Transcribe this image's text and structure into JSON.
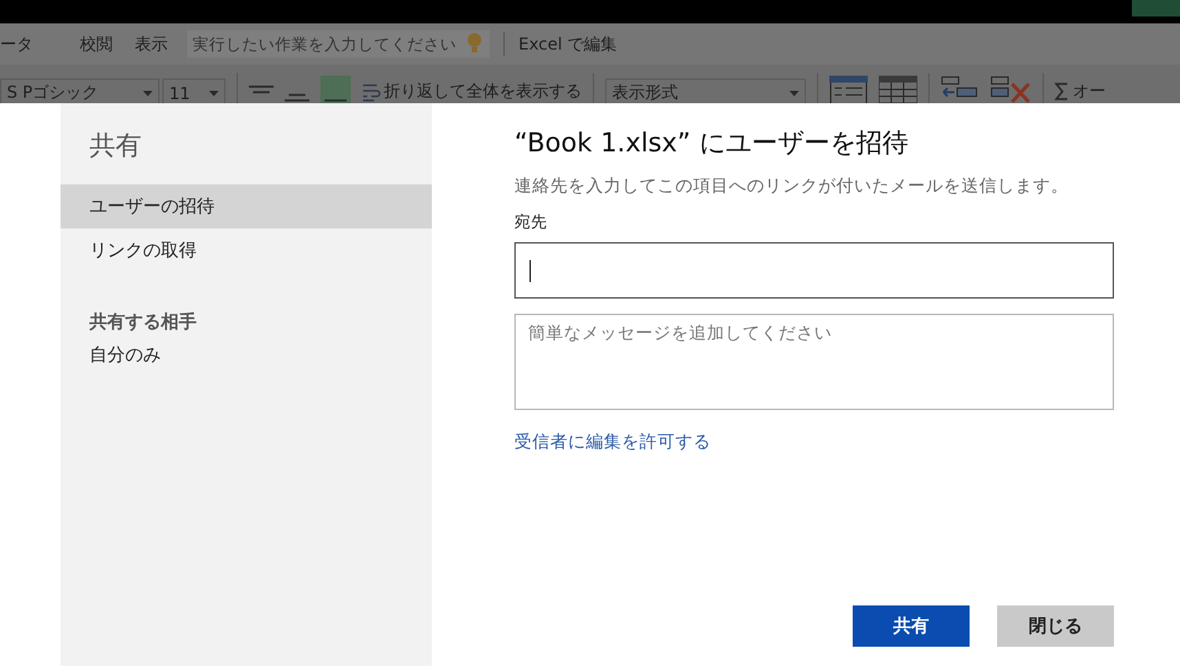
{
  "ribbon_tabs": [
    {
      "label": "ータ"
    },
    {
      "label": "校閲"
    },
    {
      "label": "表示"
    }
  ],
  "tell_me": {
    "placeholder": "実行したい作業を入力してください"
  },
  "edit_in_excel": "Excel で編集",
  "ribbon": {
    "font": "S Pゴシック",
    "size": "11",
    "wrap_text": "折り返して全体を表示する",
    "number_format": "表示形式",
    "autosum": "オー"
  },
  "sidebar": {
    "title": "共有",
    "items": [
      {
        "label": "ユーザーの招待",
        "selected": true
      },
      {
        "label": "リンクの取得",
        "selected": false
      }
    ],
    "shared_with_heading": "共有する相手",
    "shared_with": "自分のみ"
  },
  "dialog": {
    "title": "“Book 1.xlsx” にユーザーを招待",
    "description": "連絡先を入力してこの項目へのリンクが付いたメールを送信します。",
    "to_label": "宛先",
    "message": {
      "placeholder": "簡単なメッセージを追加してください"
    },
    "allow_edit_link": "受信者に編集を許可する"
  },
  "buttons": [
    {
      "label": "共有",
      "kind": "primary"
    },
    {
      "label": "閉じる",
      "kind": "secondary"
    }
  ]
}
